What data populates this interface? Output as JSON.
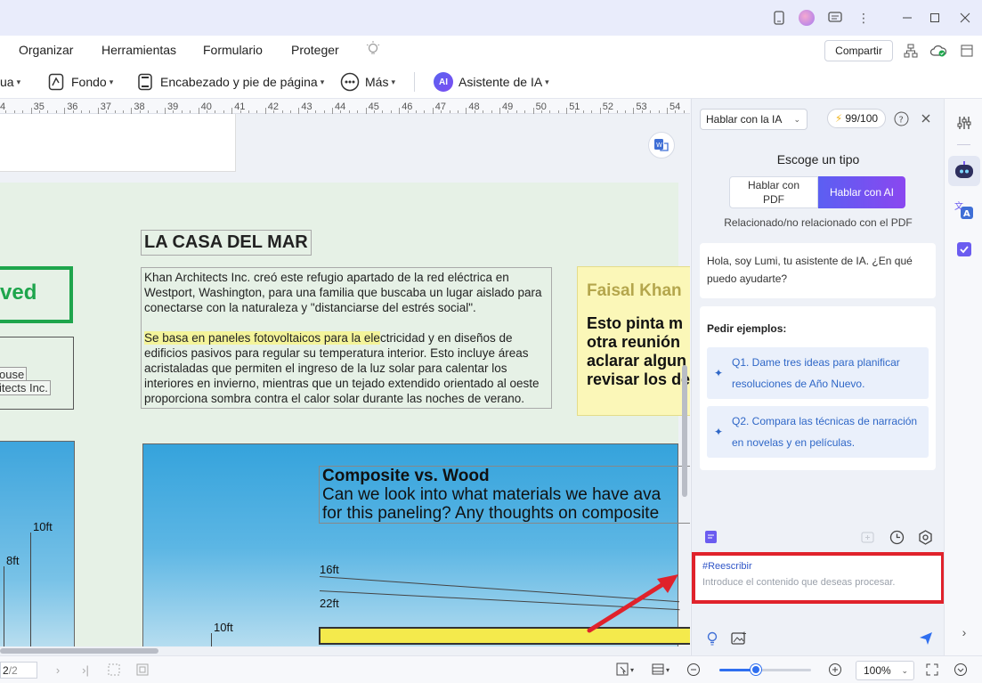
{
  "menu": {
    "items": [
      "Organizar",
      "Herramientas",
      "Formulario",
      "Proteger"
    ],
    "share_label": "Compartir"
  },
  "toolbar": {
    "partial_label": "ua",
    "background_label": "Fondo",
    "header_footer_label": "Encabezado y pie de página",
    "more_label": "Más",
    "ai_badge": "AI",
    "ai_assistant_label": "Asistente de IA"
  },
  "ruler": {
    "ticks": [
      "4",
      "35",
      "36",
      "37",
      "38",
      "39",
      "40",
      "41",
      "42",
      "43",
      "44",
      "45",
      "46",
      "47",
      "48",
      "49",
      "50",
      "51",
      "52",
      "53",
      "54"
    ]
  },
  "document": {
    "heading": "LA CASA DEL MAR",
    "paragraph1": "Khan Architects Inc. creó este refugio apartado de la red eléctrica en Westport, Washington, para una familia que buscaba un lugar aislado para conectarse con la naturaleza y \"distanciarse del estrés social\".",
    "paragraph2_highlight": "Se basa en paneles fotovoltaicos para la ele",
    "paragraph2_rest": "ctricidad y en diseños de edificios pasivos para regular su temperatura interior. Esto incluye áreas acristaladas que permiten el ingreso de la luz solar para calentar los interiores en invierno, mientras que un tejado extendido orientado al oeste proporciona sombra contra el calor solar durante las noches de verano.",
    "stamp_text": "ved",
    "box_line1": "ouse",
    "box_line2": "itects Inc.",
    "note_title": "Faisal Khan",
    "note_lines": [
      "Esto pinta m",
      "otra reunión",
      "aclarar algun",
      "revisar los de"
    ],
    "composite_title": "Composite vs. Wood",
    "composite_line1": "Can we look into what materials we have ava",
    "composite_line2": "for this paneling? Any thoughts on composite",
    "dims": {
      "d10ft_left": "10ft",
      "d8ft": "8ft",
      "d16ft": "16ft",
      "d22ft": "22ft",
      "d10ft_bottom": "10ft"
    }
  },
  "status": {
    "page_value": "2",
    "page_total": "/2",
    "zoom": 100,
    "zoom_label": "100%"
  },
  "ai_panel": {
    "mode": "Hablar con la IA",
    "quota": "99/100",
    "choose_title": "Escoge un tipo",
    "seg_pdf": "Hablar con PDF",
    "seg_ai": "Hablar con AI",
    "related": "Relacionado/no relacionado con el PDF",
    "greeting": "Hola, soy Lumi, tu asistente de IA. ¿En qué puedo ayudarte?",
    "examples_title": "Pedir ejemplos:",
    "examples": [
      "Q1. Dame tres ideas para planificar resoluciones de Año Nuevo.",
      "Q2. Compara las técnicas de narración en novelas y en películas."
    ],
    "input_tag": "#Reescribir",
    "input_placeholder": "Introduce el contenido que deseas procesar."
  },
  "colors": {
    "accent": "#2f6ff0",
    "ai_gradient_start": "#5b5ff2",
    "ai_gradient_end": "#8a47f0",
    "highlight_red": "#e0222b",
    "stamp_green": "#1ea54c"
  }
}
